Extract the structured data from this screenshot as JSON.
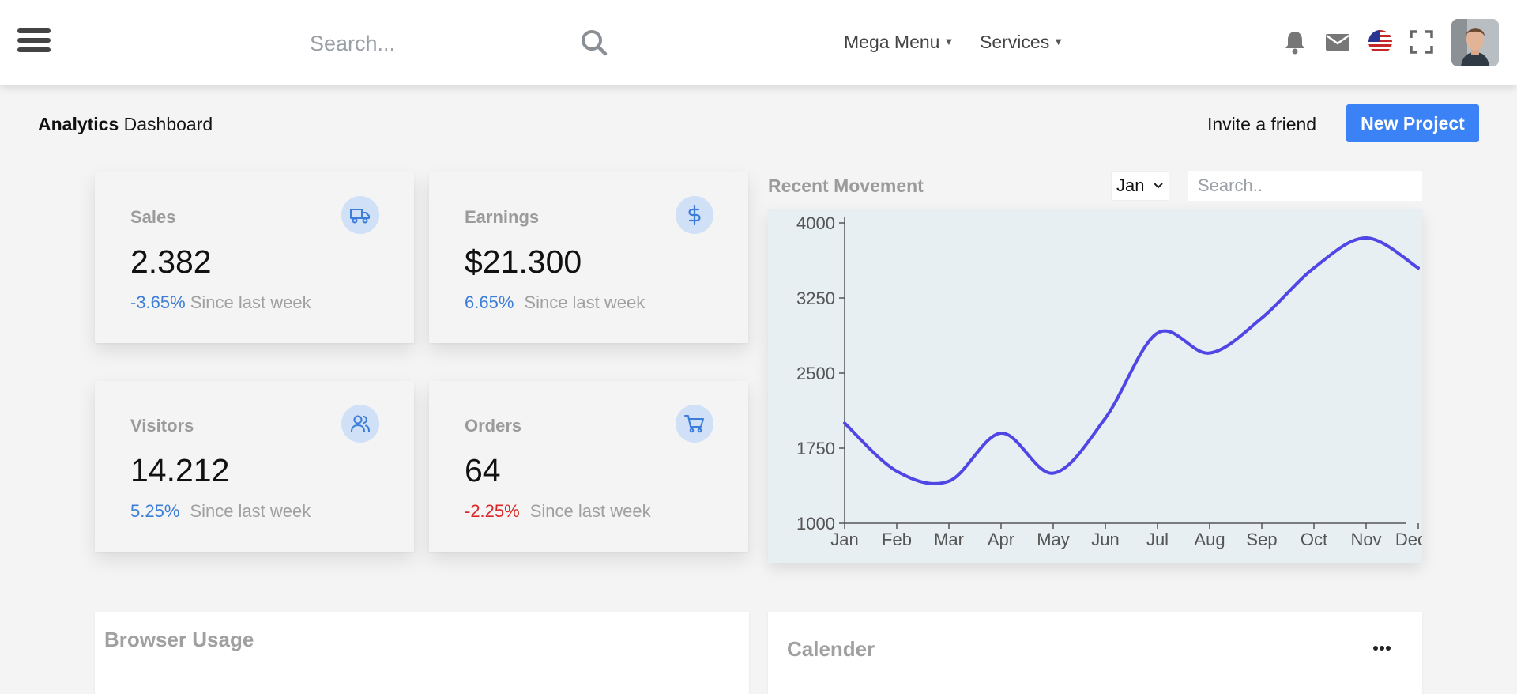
{
  "navbar": {
    "search_placeholder": "Search...",
    "menus": [
      {
        "label": "Mega Menu"
      },
      {
        "label": "Services"
      }
    ],
    "icons": [
      "menu-icon",
      "search-icon",
      "bell-icon",
      "envelope-icon",
      "us-flag-icon",
      "fullscreen-icon"
    ]
  },
  "header": {
    "title_bold": "Analytics",
    "title_rest": " Dashboard",
    "invite_label": "Invite a friend",
    "new_project_label": "New Project"
  },
  "stats": [
    {
      "label": "Sales",
      "value": "2.382",
      "change": "-3.65%",
      "since": "Since last week",
      "icon": "truck-icon",
      "change_color": "#3b7dd8"
    },
    {
      "label": "Earnings",
      "value": "$21.300",
      "change": "6.65%",
      "since": "Since last week",
      "icon": "dollar-icon",
      "change_color": "#3b7dd8"
    },
    {
      "label": "Visitors",
      "value": "14.212",
      "change": "5.25%",
      "since": "Since last week",
      "icon": "users-icon",
      "change_color": "#3b7dd8"
    },
    {
      "label": "Orders",
      "value": "64",
      "change": "-2.25%",
      "since": "Since last week",
      "icon": "cart-icon",
      "change_color": "#dc2626"
    }
  ],
  "recent_movement": {
    "title": "Recent Movement",
    "month_selected": "Jan",
    "search_placeholder": "Search.."
  },
  "chart_data": {
    "type": "line",
    "title": "",
    "xlabel": "",
    "ylabel": "",
    "categories": [
      "Jan",
      "Feb",
      "Mar",
      "Apr",
      "May",
      "Jun",
      "Jul",
      "Aug",
      "Sep",
      "Oct",
      "Nov",
      "Dec"
    ],
    "values": [
      2000,
      1520,
      1420,
      1900,
      1500,
      2050,
      2900,
      2700,
      3050,
      3550,
      3850,
      3550
    ],
    "ylim": [
      1000,
      4000
    ],
    "yticks": [
      "4000",
      "3250",
      "2500",
      "1750",
      "1000"
    ],
    "line_color": "#4f46e5",
    "grid": false
  },
  "panels": {
    "browser_usage_title": "Browser Usage",
    "calender_title": "Calender"
  }
}
